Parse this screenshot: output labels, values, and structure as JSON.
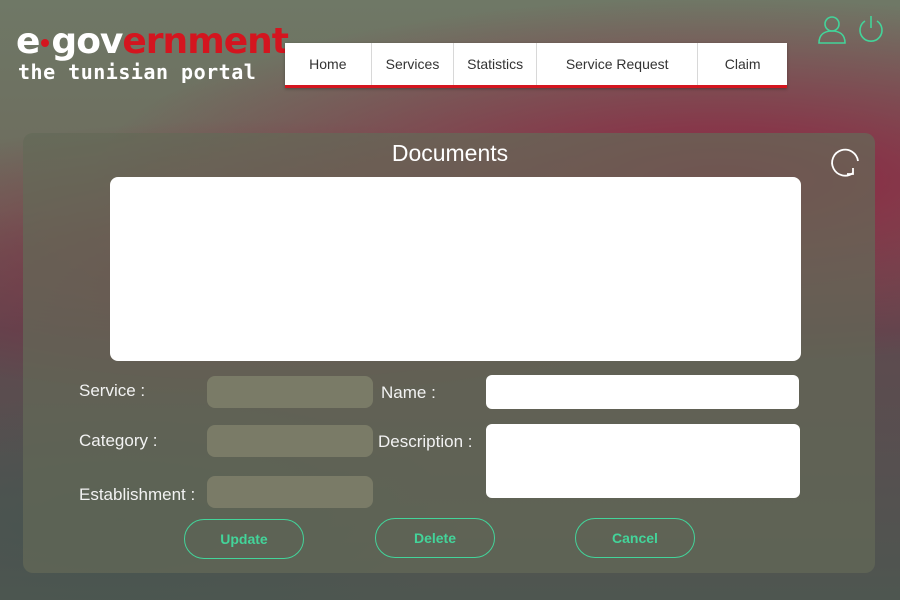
{
  "logo": {
    "part1": "e",
    "part2": "gov",
    "part3": "ernment",
    "subtitle": "the tunisian portal"
  },
  "nav": {
    "items": [
      {
        "label": "Home"
      },
      {
        "label": "Services"
      },
      {
        "label": "Statistics"
      },
      {
        "label": "Service Request"
      },
      {
        "label": "Claim"
      }
    ]
  },
  "header_icons": [
    "user-icon",
    "power-icon"
  ],
  "panel": {
    "title": "Documents",
    "refresh_icon": "refresh-icon"
  },
  "form": {
    "service_label": "Service :",
    "category_label": "Category :",
    "establishment_label": "Establishment :",
    "name_label": "Name :",
    "description_label": "Description :",
    "service_value": "",
    "category_value": "",
    "establishment_value": "",
    "name_value": "",
    "description_value": ""
  },
  "buttons": {
    "update": "Update",
    "delete": "Delete",
    "cancel": "Cancel"
  },
  "colors": {
    "accent": "#43d49a",
    "brand_red": "#d4151f",
    "panel_bg": "#646958"
  }
}
